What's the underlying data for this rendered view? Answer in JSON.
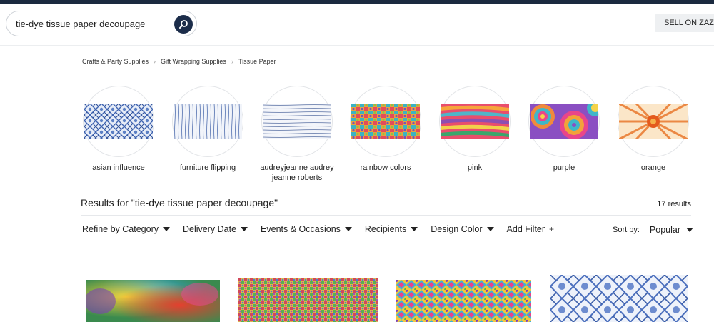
{
  "search": {
    "value": "tie-dye tissue paper decoupage"
  },
  "header": {
    "sell_label": "SELL ON ZAZZLE"
  },
  "breadcrumb": [
    "Crafts & Party Supplies",
    "Gift Wrapping Supplies",
    "Tissue Paper"
  ],
  "categories": [
    {
      "label": "asian influence"
    },
    {
      "label": "furniture flipping"
    },
    {
      "label": "audreyjeanne audrey jeanne roberts"
    },
    {
      "label": "rainbow colors"
    },
    {
      "label": "pink"
    },
    {
      "label": "purple"
    },
    {
      "label": "orange"
    }
  ],
  "results": {
    "title": "Results for \"tie-dye tissue paper decoupage\"",
    "count": "17 results"
  },
  "filters": [
    {
      "label": "Refine by Category"
    },
    {
      "label": "Delivery Date"
    },
    {
      "label": "Events & Occasions"
    },
    {
      "label": "Recipients"
    },
    {
      "label": "Design Color"
    },
    {
      "label": "Add Filter"
    }
  ],
  "sort": {
    "label": "Sort by:",
    "value": "Popular"
  },
  "icons": {
    "search": "search-icon",
    "caret": "caret-down-icon",
    "plus": "plus-icon",
    "breadcrumb_sep": "chevron-right-icon"
  },
  "colors": {
    "topbar": "#1b2a3f",
    "search_button": "#1c2d4a"
  }
}
